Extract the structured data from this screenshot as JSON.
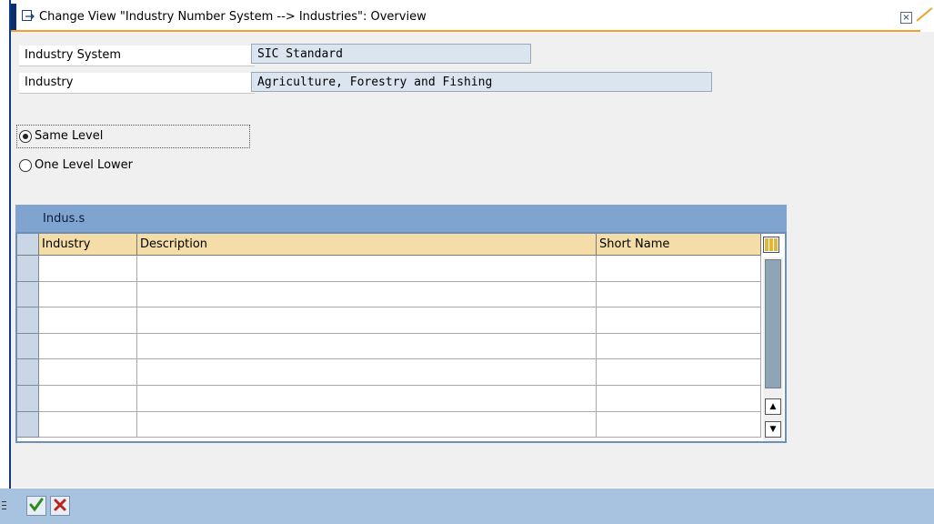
{
  "window": {
    "title": "Change View \"Industry Number System --> Industries\": Overview",
    "icons": {
      "title": "transaction-arrow-icon",
      "close": "close-window-icon"
    }
  },
  "fields": {
    "industry_system_label": "Industry System",
    "industry_system_value": "SIC Standard",
    "industry_label": "Industry",
    "industry_value": "Agriculture, Forestry and Fishing"
  },
  "radio": {
    "same_level": {
      "label": "Same Level",
      "selected": true
    },
    "one_level_lower": {
      "label": "One Level Lower",
      "selected": false
    }
  },
  "table": {
    "title": "Indus.s",
    "columns": [
      "Industry",
      "Description",
      "Short Name"
    ],
    "rows": [
      [
        "",
        "",
        ""
      ],
      [
        "",
        "",
        ""
      ],
      [
        "",
        "",
        ""
      ],
      [
        "",
        "",
        ""
      ],
      [
        "",
        "",
        ""
      ],
      [
        "",
        "",
        ""
      ],
      [
        "",
        "",
        ""
      ]
    ]
  },
  "footer": {
    "icons": [
      "confirm-checkmark-icon",
      "cancel-x-icon"
    ]
  },
  "colors": {
    "header_bg": "#f4dda6",
    "table_title_bg": "#7fa4cf",
    "footer_bg": "#a8c3e0",
    "accent_orange": "#f0a22d",
    "confirm_green": "#2e8b1e",
    "cancel_red": "#c0201a"
  }
}
